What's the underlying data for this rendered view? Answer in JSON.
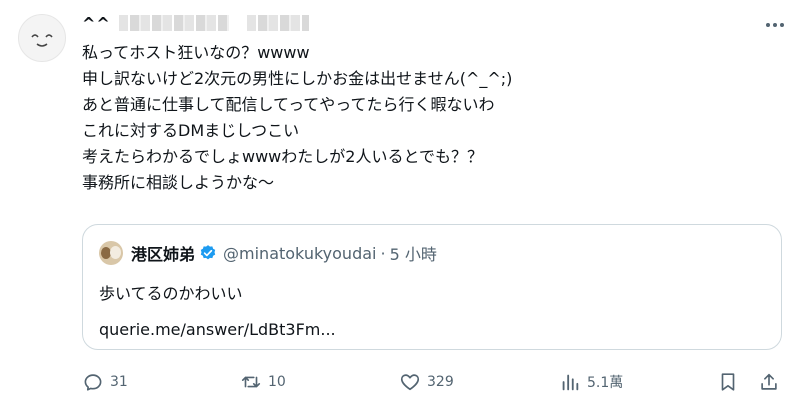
{
  "author": {
    "display_name": "^^",
    "avatar_icon": "smiley-avatar"
  },
  "tweet": {
    "lines": [
      "私ってホスト狂いなの？wwww",
      "申し訳ないけど2次元の男性にしかお金は出せません(^_^;)",
      "あと普通に仕事して配信してってやってたら行く暇ないわ",
      "これに対するDMまじしつこい",
      "考えたらわかるでしょwwwわたしが2人いるとでも？？",
      "事務所に相談しようかな〜"
    ]
  },
  "quote": {
    "name": "港区姉弟",
    "handle": "@minatokukyoudai",
    "separator": "·",
    "time": "5 小時",
    "text": "歩いてるのかわいい",
    "link": "querie.me/answer/LdBt3Fm..."
  },
  "actions": {
    "reply_count": "31",
    "retweet_count": "10",
    "like_count": "329",
    "view_count": "5.1萬"
  },
  "colors": {
    "text": "#0f1419",
    "secondary": "#536471",
    "verified": "#1d9bf0",
    "border": "#cfd9de"
  }
}
